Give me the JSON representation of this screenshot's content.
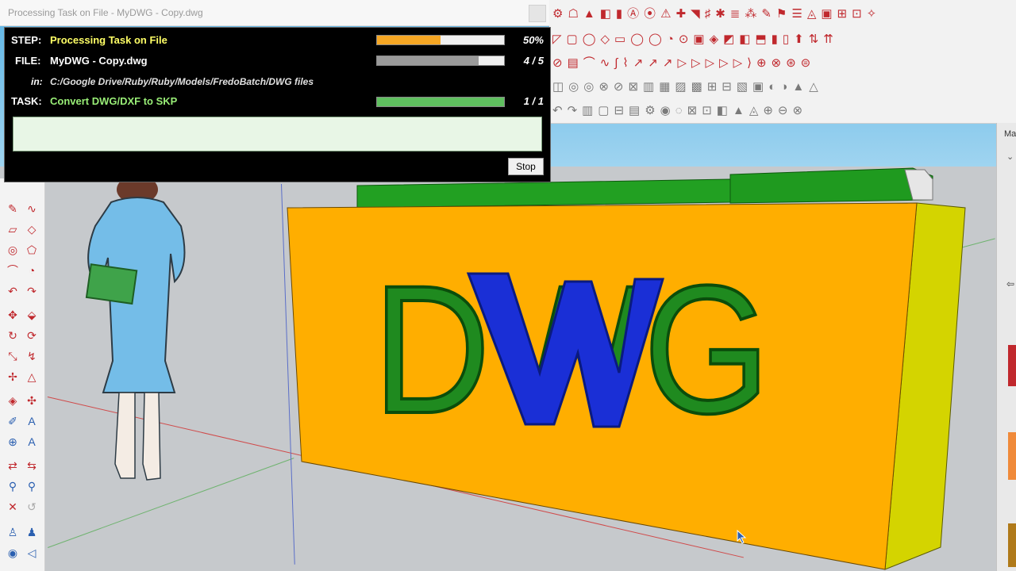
{
  "window": {
    "title": "Processing Task on File - MyDWG - Copy.dwg"
  },
  "progress": {
    "step": {
      "label": "STEP:",
      "value": "Processing Task on File",
      "percent_text": "50%",
      "fraction": 0.5
    },
    "file": {
      "label": "FILE:",
      "value": "MyDWG - Copy.dwg",
      "count_text": "4 / 5",
      "fraction": 0.8
    },
    "folder": {
      "label": "in:",
      "value": "C:/Google Drive/Ruby/Ruby/Models/FredoBatch/DWG files"
    },
    "task": {
      "label": "TASK:",
      "value": "Convert DWG/DXF to SKP",
      "count_text": "1 / 1",
      "fraction": 1.0
    },
    "stop_label": "Stop"
  },
  "scene": {
    "model_text": "DWG"
  },
  "right_panel": {
    "tab_label": "Ma"
  },
  "colors": {
    "step_text": "#ffff66",
    "task_text": "#99ee77",
    "step_bar": "#f5a623",
    "file_bar": "#9a9a9a",
    "task_bar": "#5fbf5f",
    "box_front": "#ffae00",
    "box_side": "#d4d400",
    "letter_green": "#1f8a1f",
    "letter_blue": "#1a2fd6"
  },
  "icons": [
    "pencil-icon",
    "rectangle-icon",
    "circle-icon",
    "arc-icon",
    "move-icon",
    "rotate-icon",
    "scale-icon",
    "tape-icon",
    "text-icon",
    "orbit-icon",
    "pan-icon",
    "zoom-icon",
    "walk-icon",
    "eye-icon"
  ]
}
